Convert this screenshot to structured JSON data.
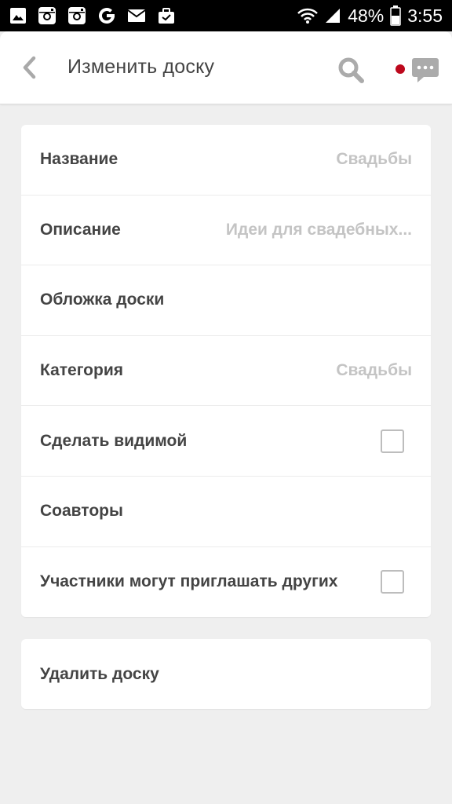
{
  "status_bar": {
    "battery": "48%",
    "time": "3:55",
    "icons": [
      "gallery-icon",
      "instagram-icon",
      "instagram-icon",
      "google-icon",
      "mail-icon",
      "briefcase-icon",
      "wifi-icon",
      "signal-icon",
      "battery-icon"
    ]
  },
  "header": {
    "title": "Изменить доску",
    "accent_color": "#bd081c"
  },
  "form": {
    "rows": [
      {
        "label": "Название",
        "value": "Свадьбы"
      },
      {
        "label": "Описание",
        "value": "Идеи для свадебных..."
      },
      {
        "label": "Обложка доски",
        "value": ""
      },
      {
        "label": "Категория",
        "value": "Свадьбы"
      },
      {
        "label": "Сделать видимой",
        "checked": false
      },
      {
        "label": "Соавторы",
        "value": ""
      },
      {
        "label": "Участники могут приглашать других",
        "checked": false
      }
    ]
  },
  "delete_board": {
    "label": "Удалить доску"
  }
}
